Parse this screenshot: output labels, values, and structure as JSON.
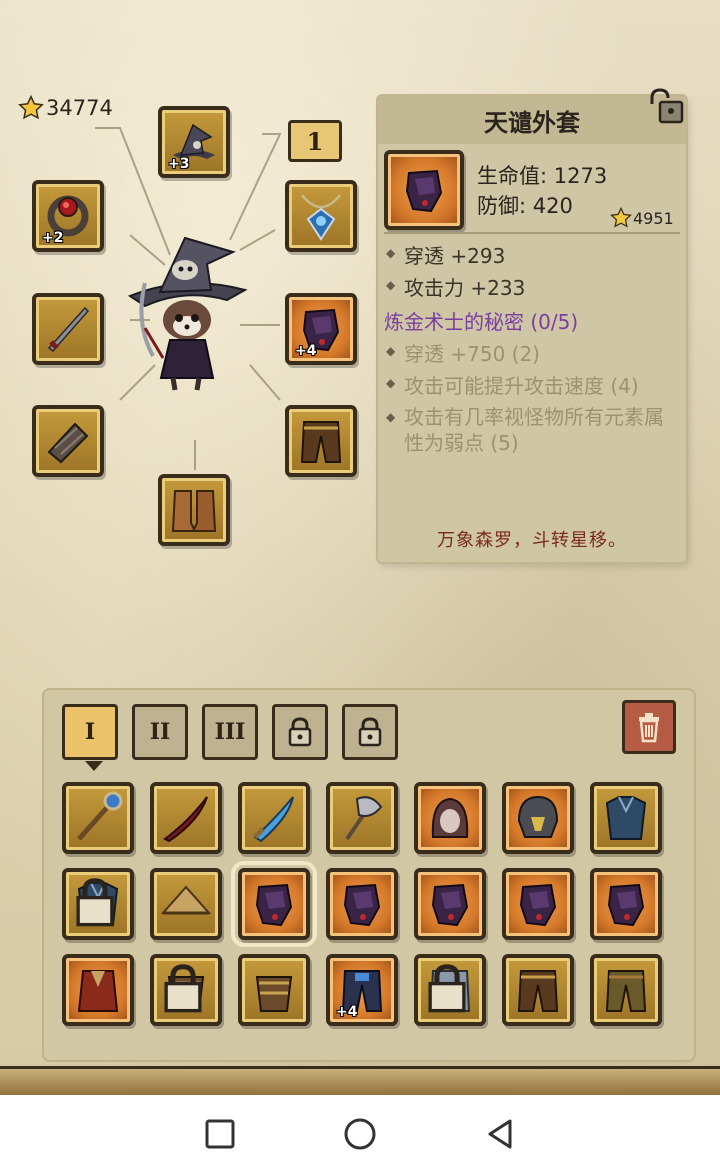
{
  "character": {
    "rating": "34774",
    "level": "1",
    "equipped": [
      {
        "name": "wizard-hat-icon",
        "plus": "+3"
      },
      {
        "name": "ring-icon",
        "plus": "+2"
      },
      {
        "name": "amulet-icon",
        "plus": ""
      },
      {
        "name": "sword-icon",
        "plus": ""
      },
      {
        "name": "gauntlet-icon",
        "plus": "+4"
      },
      {
        "name": "bracer-icon",
        "plus": ""
      },
      {
        "name": "pants-icon",
        "plus": ""
      },
      {
        "name": "boots-icon",
        "plus": ""
      }
    ]
  },
  "item_detail": {
    "title": "天谴外套",
    "hp": "生命值: 1273",
    "defense": "防御: 420",
    "rating": "4951",
    "attributes": [
      "穿透 +293",
      "攻击力 +233"
    ],
    "set_name": "炼金术士的秘密 (0/5)",
    "set_bonuses": [
      "穿透 +750 (2)",
      "攻击可能提升攻击速度 (4)",
      "攻击有几率视怪物所有元素属性为弱点 (5)"
    ],
    "flavor": "万象森罗，斗转星移。"
  },
  "inventory": {
    "tabs": [
      "I",
      "II",
      "III"
    ],
    "locked_tabs": 2,
    "rows": [
      [
        {
          "icon": "staff-icon",
          "plus": ""
        },
        {
          "icon": "red-blade-icon",
          "plus": ""
        },
        {
          "icon": "ice-sword-icon",
          "plus": ""
        },
        {
          "icon": "axe-icon",
          "plus": ""
        },
        {
          "icon": "hood-icon",
          "plus": ""
        },
        {
          "icon": "helmet-icon",
          "plus": ""
        },
        {
          "icon": "armor-icon",
          "plus": ""
        }
      ],
      [
        {
          "icon": "armor-icon",
          "plus": ""
        },
        {
          "icon": "straw-hat-icon",
          "plus": ""
        },
        {
          "icon": "gauntlet-icon",
          "plus": ""
        },
        {
          "icon": "gauntlet-icon",
          "plus": ""
        },
        {
          "icon": "gauntlet-icon",
          "plus": ""
        },
        {
          "icon": "gauntlet-icon",
          "plus": ""
        },
        {
          "icon": "gauntlet-icon",
          "plus": ""
        }
      ],
      [
        {
          "icon": "robe-icon",
          "plus": ""
        },
        {
          "icon": "bracer-icon",
          "plus": ""
        },
        {
          "icon": "bracer-icon",
          "plus": ""
        },
        {
          "icon": "belt-pants-icon",
          "plus": "+4"
        },
        {
          "icon": "pants-icon",
          "plus": ""
        },
        {
          "icon": "pants-icon",
          "plus": ""
        },
        {
          "icon": "pants-icon",
          "plus": ""
        }
      ]
    ]
  },
  "colors": {
    "accent": "#ecc36a",
    "set_purple": "#7a3ea0",
    "flavor_red": "#7a2b1a"
  }
}
